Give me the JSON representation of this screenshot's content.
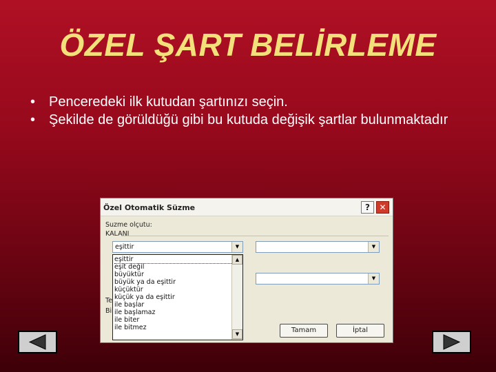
{
  "slide": {
    "title": "ÖZEL ŞART BELİRLEME",
    "bullets": [
      "Penceredeki ilk kutudan şartınızı seçin.",
      "Şekilde de görüldüğü gibi bu kutuda değişik şartlar bulunmaktadır"
    ],
    "bullet_glyph": "•"
  },
  "dialog": {
    "title": "Özel Otomatik Süzme",
    "help_label": "?",
    "close_label": "✕",
    "criteria_label": "Suzme olçutu:",
    "field_label": "KALANI",
    "partial_label_1": "Te",
    "partial_label_2": "Bi",
    "combo1_value": "eşittir",
    "combo2_value": "",
    "combo3_value": "",
    "dropdown_options": [
      "eşittir",
      "eşit değil",
      "büyüktür",
      "büyük ya da eşittir",
      "küçüktür",
      "küçük ya da eşittir",
      "ile başlar",
      "ile başlamaz",
      "ile biter",
      "ile bitmez"
    ],
    "ok_label": "Tamam",
    "cancel_label": "İptal"
  },
  "navigation": {
    "prev_icon": "triangle-left-icon",
    "next_icon": "triangle-right-icon"
  }
}
